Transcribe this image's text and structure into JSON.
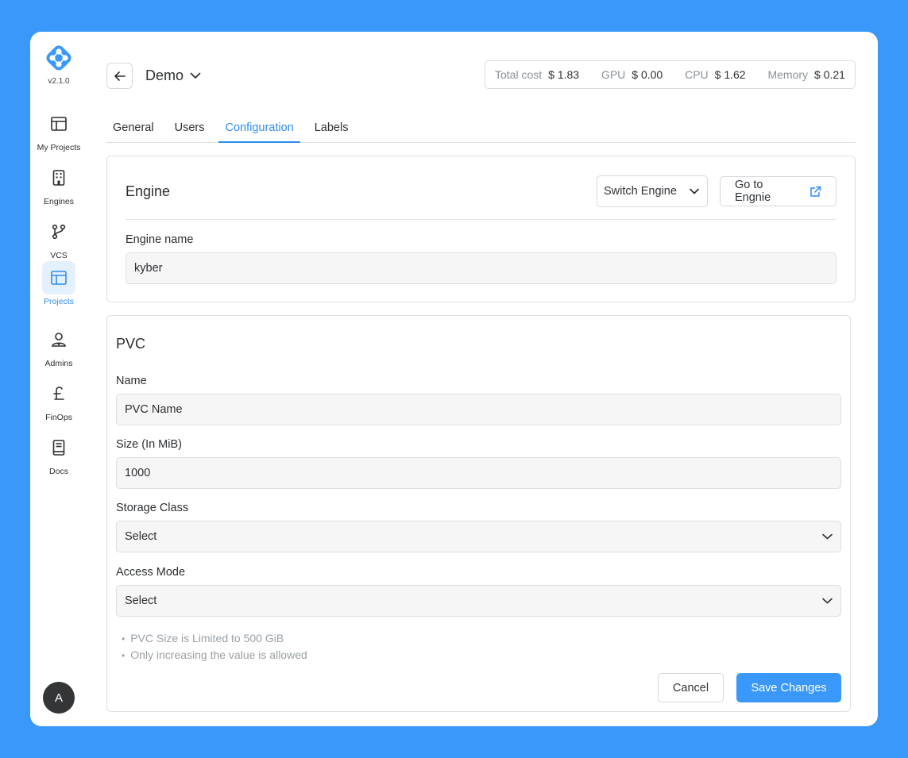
{
  "app": {
    "version": "v2.1.0",
    "accent_color": "#2f8cf0",
    "background_color": "#3a98fb"
  },
  "sidebar": {
    "items": [
      {
        "label": "My Projects",
        "icon": "layout-icon"
      },
      {
        "label": "Engines",
        "icon": "building-icon"
      },
      {
        "label": "VCS",
        "icon": "git-branch-icon"
      },
      {
        "label": "Projects",
        "icon": "layout-icon",
        "active": true
      },
      {
        "label": "Admins",
        "icon": "user-admin-icon"
      },
      {
        "label": "FinOps",
        "icon": "pound-icon"
      },
      {
        "label": "Docs",
        "icon": "book-icon"
      }
    ],
    "avatar_initial": "A"
  },
  "header": {
    "project_name": "Demo",
    "costs": [
      {
        "label": "Total cost",
        "value": "$ 1.83"
      },
      {
        "label": "GPU",
        "value": "$ 0.00"
      },
      {
        "label": "CPU",
        "value": "$ 1.62"
      },
      {
        "label": "Memory",
        "value": "$ 0.21"
      }
    ]
  },
  "tabs": [
    {
      "label": "General"
    },
    {
      "label": "Users"
    },
    {
      "label": "Configuration",
      "active": true
    },
    {
      "label": "Labels"
    }
  ],
  "engine": {
    "title": "Engine",
    "switch_label": "Switch Engine",
    "goto_label": "Go to Engnie",
    "name_label": "Engine name",
    "name_value": "kyber"
  },
  "pvc": {
    "title": "PVC",
    "name_label": "Name",
    "name_placeholder": "PVC Name",
    "size_label": "Size (In MiB)",
    "size_value": "1000",
    "storage_label": "Storage Class",
    "storage_value": "Select",
    "access_label": "Access Mode",
    "access_value": "Select",
    "notes": [
      "PVC Size is Limited to 500 GiB",
      "Only increasing the value is allowed"
    ],
    "cancel_label": "Cancel",
    "save_label": "Save Changes"
  }
}
